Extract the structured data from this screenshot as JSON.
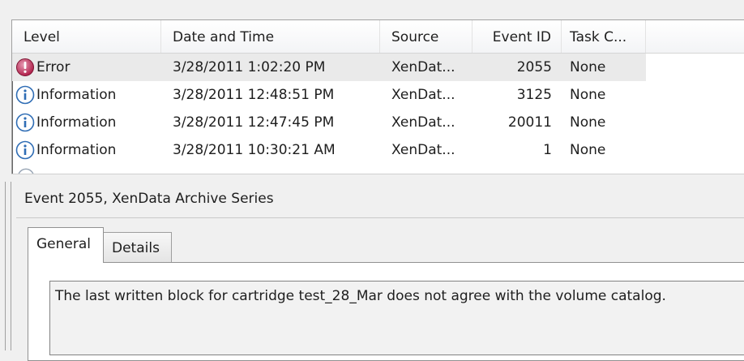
{
  "event_list": {
    "columns": {
      "level": "Level",
      "datetime": "Date and Time",
      "source": "Source",
      "event_id": "Event ID",
      "task_category": "Task C..."
    },
    "rows": [
      {
        "level": "Error",
        "level_icon": "error-icon",
        "datetime": "3/28/2011 1:02:20 PM",
        "source": "XenDat...",
        "event_id": "2055",
        "task_category": "None"
      },
      {
        "level": "Information",
        "level_icon": "info-icon",
        "datetime": "3/28/2011 12:48:51 PM",
        "source": "XenDat...",
        "event_id": "3125",
        "task_category": "None"
      },
      {
        "level": "Information",
        "level_icon": "info-icon",
        "datetime": "3/28/2011 12:47:45 PM",
        "source": "XenDat...",
        "event_id": "20011",
        "task_category": "None"
      },
      {
        "level": "Information",
        "level_icon": "info-icon",
        "datetime": "3/28/2011 10:30:21 AM",
        "source": "XenDat...",
        "event_id": "1",
        "task_category": "None"
      }
    ]
  },
  "details": {
    "title": "Event 2055, XenData Archive Series",
    "tabs": [
      {
        "label": "General",
        "selected": true
      },
      {
        "label": "Details",
        "selected": false
      }
    ],
    "message": "The last written block for cartridge test_28_Mar does not agree with the volume catalog."
  },
  "colors": {
    "error_icon": "#b0204a",
    "info_icon": "#2f6db5",
    "selected_row": "#eaeaea"
  }
}
